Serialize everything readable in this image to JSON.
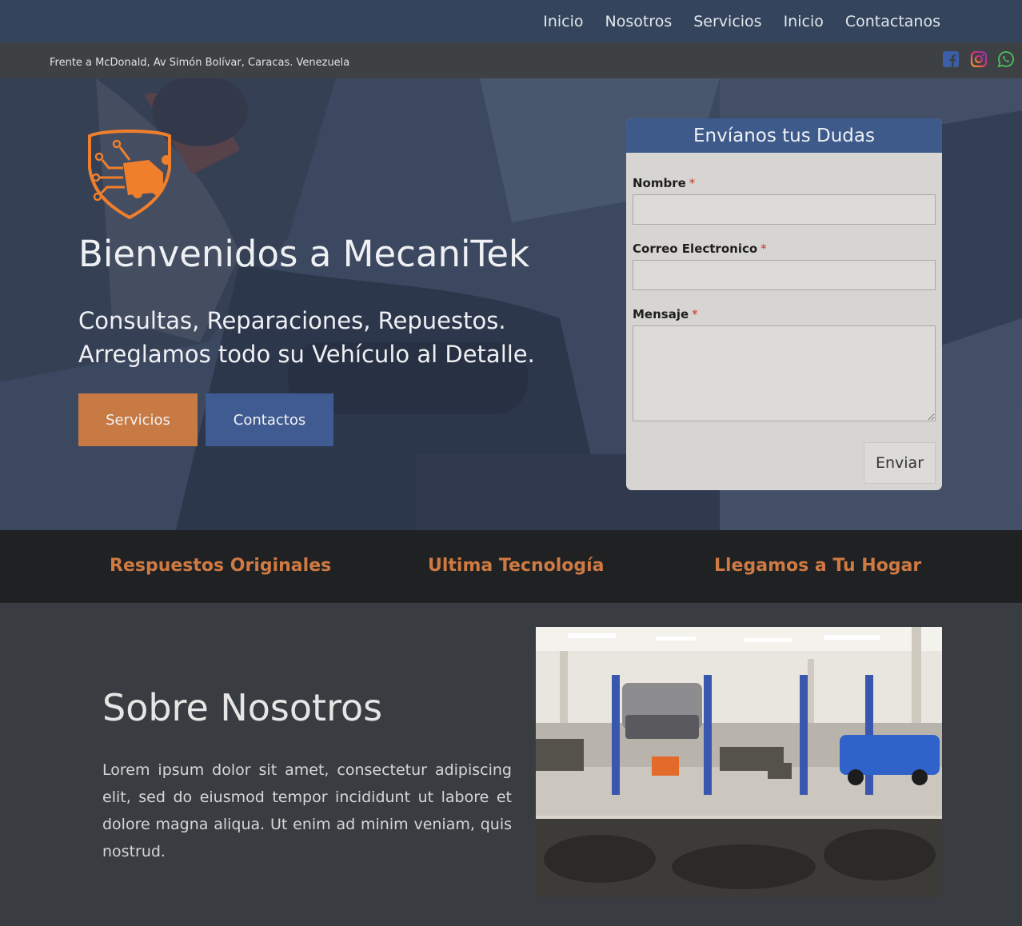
{
  "nav": {
    "items": [
      "Inicio",
      "Nosotros",
      "Servicios",
      "Inicio",
      "Contactanos"
    ]
  },
  "infobar": {
    "address": "Frente a McDonald, Av Simón Bolívar, Caracas. Venezuela",
    "social": [
      "facebook-icon",
      "instagram-icon",
      "whatsapp-icon"
    ]
  },
  "hero": {
    "title": "Bienvenidos a MecaniTek",
    "subtitle": "Consultas, Reparaciones, Repuestos. Arreglamos todo su Vehículo al Detalle.",
    "services_button": "Servicios",
    "contact_button": "Contactos"
  },
  "form": {
    "title": "Envíanos tus Dudas",
    "name_label": "Nombre",
    "email_label": "Correo Electronico",
    "message_label": "Mensaje",
    "required_mark": "*",
    "submit_label": "Enviar"
  },
  "features": {
    "items": [
      "Respuestos Originales",
      "Ultima Tecnología",
      "Llegamos a Tu Hogar"
    ]
  },
  "about": {
    "title": "Sobre Nosotros",
    "text": "Lorem ipsum dolor sit amet, consectetur adipiscing elit, sed do eiusmod tempor incididunt ut labore et dolore magna aliqua. Ut enim ad minim veniam, quis nostrud."
  },
  "colors": {
    "nav_bg": "#33445c",
    "accent_orange": "#c77a44",
    "accent_blue": "#3f5b92",
    "feature_text": "#cf7a43"
  }
}
